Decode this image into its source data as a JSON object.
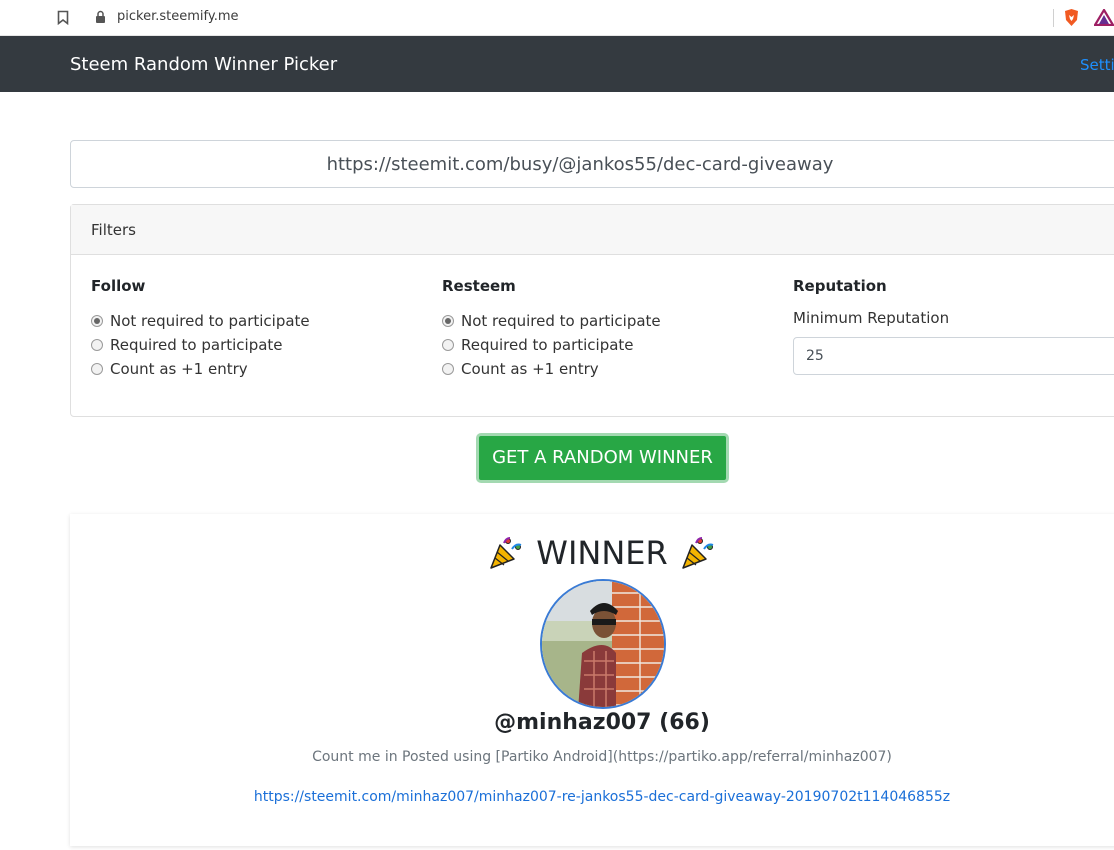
{
  "browser": {
    "url": "picker.steemify.me"
  },
  "navbar": {
    "brand": "Steem Random Winner Picker",
    "settings_label": "Settin"
  },
  "post_input": {
    "value": "https://steemit.com/busy/@jankos55/dec-card-giveaway"
  },
  "filters": {
    "header": "Filters",
    "follow": {
      "title": "Follow",
      "options": [
        "Not required to participate",
        "Required to participate",
        "Count as +1 entry"
      ],
      "selected": "Not required to participate"
    },
    "resteem": {
      "title": "Resteem",
      "options": [
        "Not required to participate",
        "Required to participate",
        "Count as +1 entry"
      ],
      "selected": "Not required to participate"
    },
    "reputation": {
      "title": "Reputation",
      "label": "Minimum Reputation",
      "value": "25"
    }
  },
  "action": {
    "button_label": "GET A RANDOM WINNER"
  },
  "winner": {
    "heading": "WINNER",
    "username": "@minhaz007 (66)",
    "comment": "Count me in Posted using [Partiko Android](https://partiko.app/referral/minhaz007)",
    "link": "https://steemit.com/minhaz007/minhaz007-re-jankos55-dec-card-giveaway-20190702t114046855z"
  },
  "colors": {
    "navbar_bg": "#343a40",
    "button_bg": "#28a745",
    "link": "#1a6fd8"
  }
}
